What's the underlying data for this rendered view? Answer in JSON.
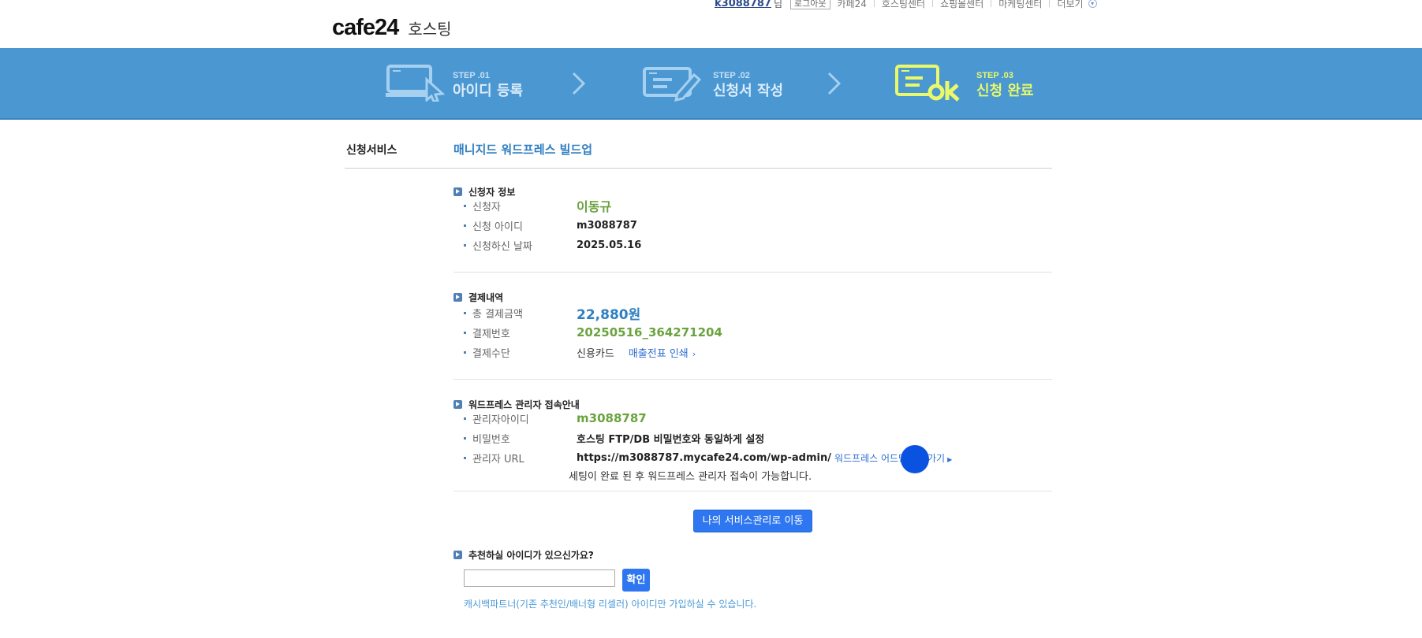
{
  "header": {
    "brand": "cafe24",
    "brand_sub": "호스팅",
    "user_id": "k3088787",
    "user_suffix": "님",
    "logout": "로그아웃",
    "nav": [
      "카페24",
      "호스팅센터",
      "쇼핑몰센터",
      "마케팅센터",
      "더보기"
    ]
  },
  "steps": [
    {
      "num": "STEP .01",
      "title": "아이디 등록"
    },
    {
      "num": "STEP .02",
      "title": "신청서 작성"
    },
    {
      "num": "STEP .03",
      "title": "신청 완료"
    }
  ],
  "service": {
    "label": "신청서비스",
    "value": "매니지드 워드프레스 빌드업"
  },
  "applicant": {
    "title": "신청자 정보",
    "rows": [
      {
        "label": "신청자",
        "value": "이동규"
      },
      {
        "label": "신청 아이디",
        "value": "m3088787"
      },
      {
        "label": "신청하신 날짜",
        "value": "2025.05.16"
      }
    ]
  },
  "payment": {
    "title": "결제내역",
    "rows": [
      {
        "label": "총 결제금액",
        "value": "22,880원"
      },
      {
        "label": "결제번호",
        "value": "20250516_364271204"
      },
      {
        "label": "결제수단",
        "value": "신용카드"
      }
    ],
    "receipt_link": "매출전표 인쇄"
  },
  "wp_admin": {
    "title": "워드프레스 관리자 접속안내",
    "rows": [
      {
        "label": "관리자아이디",
        "value": "m3088787"
      },
      {
        "label": "비밀번호",
        "value": "호스팅 FTP/DB 비밀번호와 동일하게 설정"
      },
      {
        "label": "관리자 URL",
        "value": "https://m3088787.mycafe24.com/wp-admin/"
      }
    ],
    "admin_link": "워드프레스 어드민 바로가기",
    "note": "세팅이 완료 된 후 워드프레스 관리자 접속이 가능합니다."
  },
  "manage_button": "나의 서비스관리로 이동",
  "recommend": {
    "title": "추천하실 아이디가 있으신가요?",
    "input_value": "",
    "confirm": "확인",
    "note": "캐시백파트너(기존 추천인/배너형 리셀러) 아이디만 가입하실 수 있습니다."
  },
  "colors": {
    "banner": "#4a97d2",
    "accent_blue": "#2f7fc1",
    "accent_green": "#6aa33e",
    "button": "#2e77f0",
    "step_active": "#e9f96a"
  }
}
